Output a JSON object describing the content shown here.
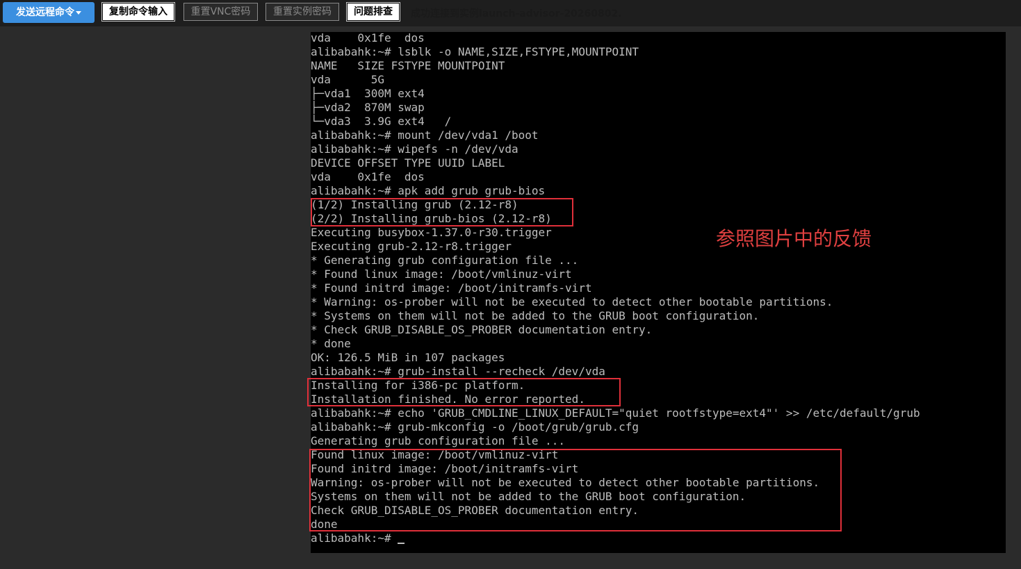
{
  "toolbar": {
    "send_remote_command": "发送远程命令",
    "copy_command_input": "复制命令输入",
    "reset_vnc_password": "重置VNC密码",
    "reset_instance_password": "重置实例密码",
    "troubleshoot": "问题排查",
    "status_message": "成功连接到实例launch-advisor-20260802."
  },
  "annotation": "参照图片中的反馈",
  "terminal": {
    "lines": [
      "vda    0x1fe  dos",
      "alibabahk:~# lsblk -o NAME,SIZE,FSTYPE,MOUNTPOINT",
      "NAME   SIZE FSTYPE MOUNTPOINT",
      "vda      5G",
      "├─vda1  300M ext4",
      "├─vda2  870M swap",
      "└─vda3  3.9G ext4   /",
      "alibabahk:~# mount /dev/vda1 /boot",
      "alibabahk:~# wipefs -n /dev/vda",
      "DEVICE OFFSET TYPE UUID LABEL",
      "vda    0x1fe  dos",
      "alibabahk:~# apk add grub grub-bios",
      "(1/2) Installing grub (2.12-r8)",
      "(2/2) Installing grub-bios (2.12-r8)",
      "Executing busybox-1.37.0-r30.trigger",
      "Executing grub-2.12-r8.trigger",
      "* Generating grub configuration file ...",
      "* Found linux image: /boot/vmlinuz-virt",
      "* Found initrd image: /boot/initramfs-virt",
      "* Warning: os-prober will not be executed to detect other bootable partitions.",
      "* Systems on them will not be added to the GRUB boot configuration.",
      "* Check GRUB_DISABLE_OS_PROBER documentation entry.",
      "* done",
      "OK: 126.5 MiB in 107 packages",
      "alibabahk:~# grub-install --recheck /dev/vda",
      "Installing for i386-pc platform.",
      "Installation finished. No error reported.",
      "alibabahk:~# echo 'GRUB_CMDLINE_LINUX_DEFAULT=\"quiet rootfstype=ext4\"' >> /etc/default/grub",
      "alibabahk:~# grub-mkconfig -o /boot/grub/grub.cfg",
      "Generating grub configuration file ...",
      "Found linux image: /boot/vmlinuz-virt",
      "Found initrd image: /boot/initramfs-virt",
      "Warning: os-prober will not be executed to detect other bootable partitions.",
      "Systems on them will not be added to the GRUB boot configuration.",
      "Check GRUB_DISABLE_OS_PROBER documentation entry.",
      "done"
    ],
    "prompt": "alibabahk:~# "
  },
  "colors": {
    "accent_button": "#3b8fe0",
    "terminal_bg": "#000000",
    "terminal_text": "#bdbdbd",
    "highlight_border": "#e0303a",
    "annotation_text": "#e04040"
  }
}
